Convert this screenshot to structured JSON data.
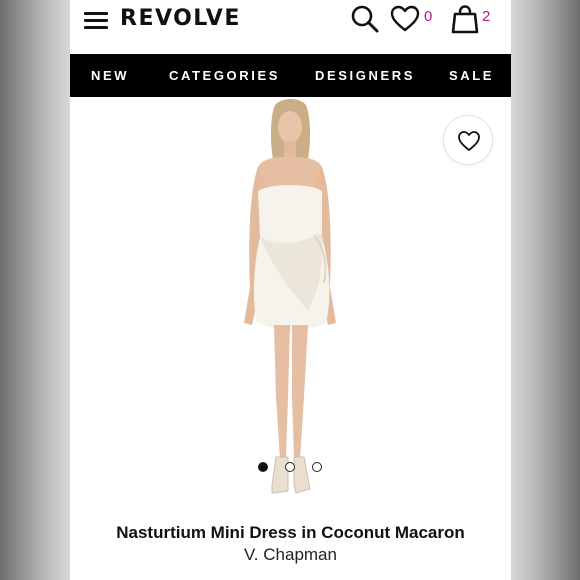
{
  "header": {
    "logo": "REVOLVE",
    "wishlist_count": "0",
    "bag_count": "2",
    "accent_color": "#b0207f"
  },
  "nav": {
    "items": [
      {
        "label": "NEW"
      },
      {
        "label": "CATEGORIES"
      },
      {
        "label": "DESIGNERS"
      },
      {
        "label": "SALE"
      }
    ]
  },
  "product": {
    "name": "Nasturtium Mini Dress in Coconut Macaron",
    "brand": "V. Chapman",
    "image_count": 3,
    "active_image_index": 1
  },
  "icons": [
    "menu-icon",
    "search-icon",
    "heart-icon",
    "shopping-bag-icon",
    "favorite-heart-icon"
  ]
}
